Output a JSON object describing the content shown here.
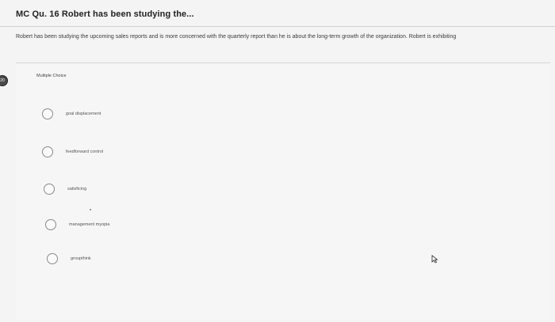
{
  "header": {
    "title": "MC Qu. 16 Robert has been studying the..."
  },
  "question": {
    "text": "Robert has been studying the upcoming sales reports and is more concerned with the quarterly report than he is about the long-term growth of the organization. Robert is exhibiting"
  },
  "side_badge": {
    "number": "20"
  },
  "card": {
    "type_label": "Multiple Choice",
    "choices": [
      {
        "label": "goal displacement"
      },
      {
        "label": "feedforward control"
      },
      {
        "label": "satisficing"
      },
      {
        "label": "management myopia"
      },
      {
        "label": "groupthink"
      }
    ]
  },
  "icons": {
    "pointer": "mouse-pointer-icon"
  }
}
